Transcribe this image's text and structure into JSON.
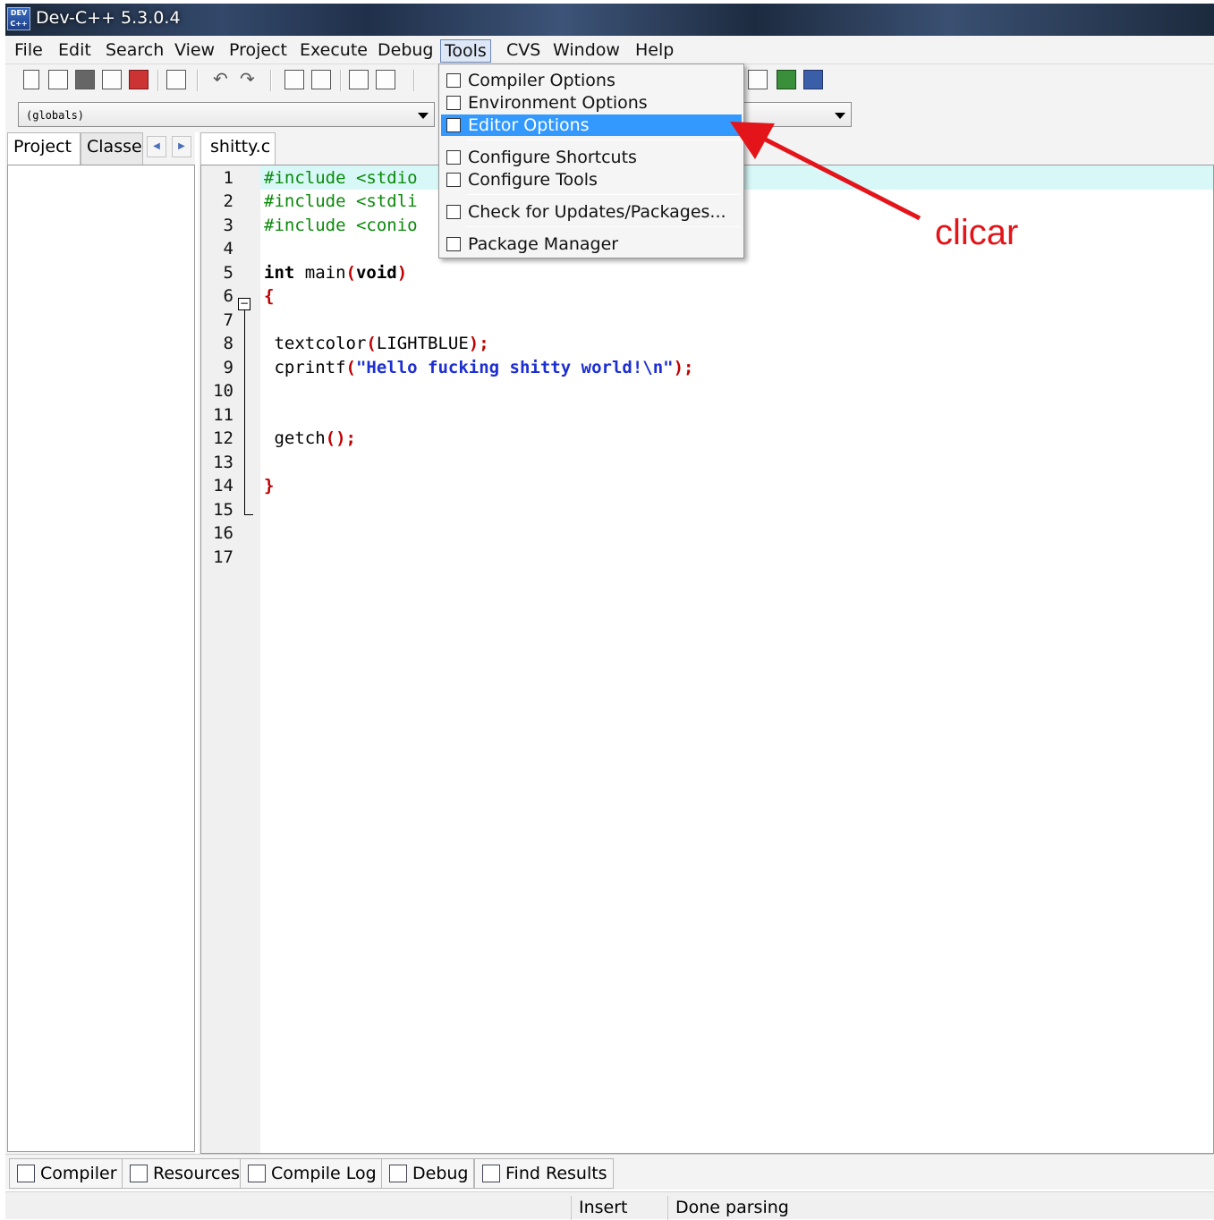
{
  "window": {
    "title": "Dev-C++ 5.3.0.4",
    "icon": "dev-cpp-app-icon"
  },
  "menubar": {
    "items": [
      "File",
      "Edit",
      "Search",
      "View",
      "Project",
      "Execute",
      "Debug",
      "Tools",
      "CVS",
      "Window",
      "Help"
    ],
    "open_item": "Tools"
  },
  "combo": {
    "scope_value": "(globals)"
  },
  "left_panel": {
    "tabs": [
      "Project",
      "Classes"
    ]
  },
  "editor": {
    "file_tab": "shitty.c",
    "line_numbers": [
      "1",
      "2",
      "3",
      "4",
      "5",
      "6",
      "7",
      "8",
      "9",
      "10",
      "11",
      "12",
      "13",
      "14",
      "15",
      "16",
      "17"
    ],
    "lines": {
      "l1_pre": "#include <stdio",
      "l2_pre": "#include <stdli",
      "l3_pre": "#include <conio",
      "l5_kw1": "int",
      "l5_id": " main",
      "l5_par_open": "(",
      "l5_kw2": "void",
      "l5_par_close": ")",
      "l6_brace": "{",
      "l8_id": " textcolor",
      "l8_open": "(",
      "l8_arg": "LIGHTBLUE",
      "l8_close": ");",
      "l9_id": " cprintf",
      "l9_open": "(",
      "l9_str": "\"Hello fucking shitty world!\\n\"",
      "l9_close": ");",
      "l12_id": " getch",
      "l12_call": "();",
      "l14_brace": "}"
    }
  },
  "tools_menu": {
    "items": [
      "Compiler Options",
      "Environment Options",
      "Editor Options",
      "Configure Shortcuts",
      "Configure Tools",
      "Check for Updates/Packages...",
      "Package Manager"
    ],
    "highlighted": "Editor Options"
  },
  "annotation": {
    "label": "clicar",
    "color": "#e3151a"
  },
  "bottom_tabs": [
    "Compiler",
    "Resources",
    "Compile Log",
    "Debug",
    "Find Results"
  ],
  "statusbar": {
    "mode": "Insert",
    "message": "Done parsing"
  },
  "colors": {
    "highlight": "#3399ff",
    "preprocessor": "#0a8a0a",
    "string": "#1d2fd1",
    "symbol": "#c00000",
    "current_line": "#d8f8f8"
  }
}
